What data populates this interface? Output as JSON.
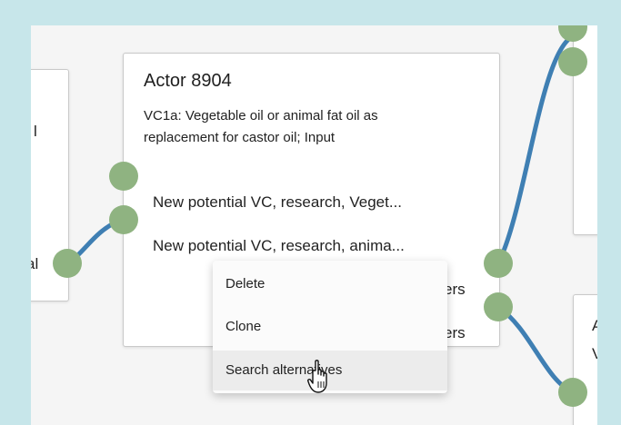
{
  "left_node": {
    "label_top": "l",
    "label_bottom": "al"
  },
  "actor_node": {
    "title": "Actor 8904",
    "description": "VC1a: Vegetable oil or animal fat oil as replacement for castor oil; Input",
    "inputs": [
      "New potential VC, research, Veget...",
      "New potential VC, research, anima..."
    ],
    "outputs": [
      "Relevant to mass producers",
      "Relevant to mass producers"
    ],
    "output_visible": [
      "ers",
      "ers"
    ]
  },
  "right_node": {
    "label_top": "A",
    "label_bottom": "V"
  },
  "context_menu": {
    "items": [
      "Delete",
      "Clone",
      "Search alternatives"
    ]
  },
  "colors": {
    "port": "#8fb381",
    "edge": "#3f7fb3",
    "background": "#c7e6ea"
  }
}
